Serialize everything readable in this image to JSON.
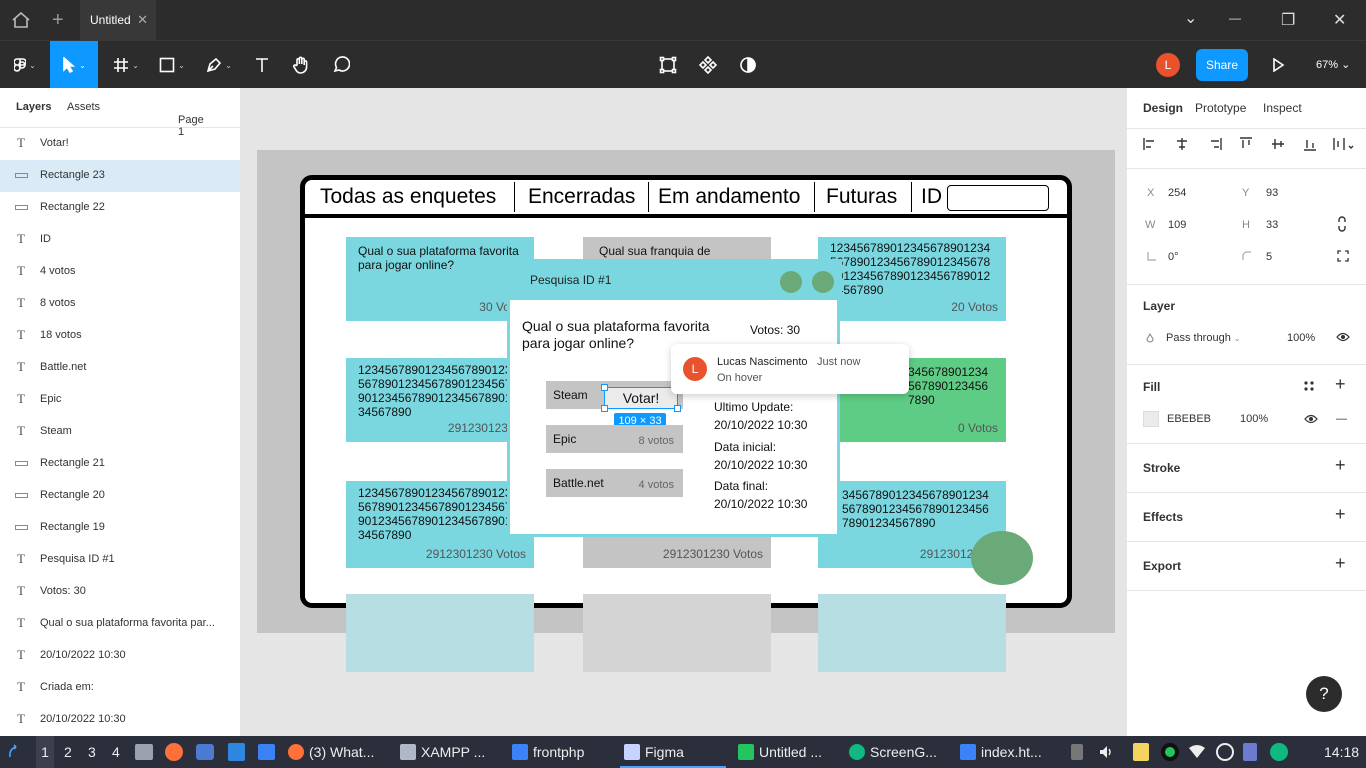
{
  "titlebar": {
    "tab_title": "Untitled",
    "close_glyph": "✕",
    "plus_glyph": "+",
    "chevron_glyph": "⌄",
    "minimize_glyph": "—",
    "restore_glyph": "❐",
    "window_close_glyph": "✕"
  },
  "toolbar": {
    "avatar_letter": "L",
    "share_label": "Share",
    "zoom_label": "67%",
    "caret": "⌄"
  },
  "left_panel": {
    "tab_layers": "Layers",
    "tab_assets": "Assets",
    "page_label": "Page 1",
    "layers": [
      {
        "type": "text",
        "name": "Votar!"
      },
      {
        "type": "rect",
        "name": "Rectangle 23",
        "selected": true
      },
      {
        "type": "rect",
        "name": "Rectangle 22"
      },
      {
        "type": "text",
        "name": "ID"
      },
      {
        "type": "text",
        "name": "4 votos"
      },
      {
        "type": "text",
        "name": "8 votos"
      },
      {
        "type": "text",
        "name": "18 votos"
      },
      {
        "type": "text",
        "name": "Battle.net"
      },
      {
        "type": "text",
        "name": "Epic"
      },
      {
        "type": "text",
        "name": "Steam"
      },
      {
        "type": "rect",
        "name": "Rectangle 21"
      },
      {
        "type": "rect",
        "name": "Rectangle 20"
      },
      {
        "type": "rect",
        "name": "Rectangle 19"
      },
      {
        "type": "text",
        "name": "Pesquisa ID #1"
      },
      {
        "type": "text",
        "name": "Votos: 30"
      },
      {
        "type": "text",
        "name": "Qual o sua plataforma favorita par..."
      },
      {
        "type": "text",
        "name": "20/10/2022 10:30"
      },
      {
        "type": "text",
        "name": "Criada em:"
      },
      {
        "type": "text",
        "name": "20/10/2022 10:30"
      }
    ]
  },
  "right_panel": {
    "tab_design": "Design",
    "tab_prototype": "Prototype",
    "tab_inspect": "Inspect",
    "x_label": "X",
    "x_value": "254",
    "y_label": "Y",
    "y_value": "93",
    "w_label": "W",
    "w_value": "109",
    "h_label": "H",
    "h_value": "33",
    "rotation": "0°",
    "radius": "5",
    "layer_heading": "Layer",
    "blend_mode": "Pass through",
    "layer_opacity": "100%",
    "fill_heading": "Fill",
    "fill_hex": "EBEBEB",
    "fill_opacity": "100%",
    "stroke_heading": "Stroke",
    "effects_heading": "Effects",
    "export_heading": "Export",
    "plus": "+",
    "minus": "—"
  },
  "canvas": {
    "nav": {
      "tabs": [
        "Todas as  enquetes",
        "Encerradas",
        "Em andamento",
        "Futuras",
        "ID"
      ]
    },
    "cards": {
      "c1_text": "Qual o sua plataforma favorita para jogar online?",
      "c1_votes": "30 Votos",
      "c2_text": "Qual sua franquia de",
      "c3_text": "12345678901234567890123456789012345678901234567890123456789012345678901234567890",
      "c3_votes": "20 Votos",
      "c4_text": "12345678901234567890123456789012345678901234567890123456789012345678901234567890",
      "c4_votes": "2912301230 Vo",
      "c6_text": "3456789012345678901234567890",
      "c6_votes": "0 Votos",
      "c7_text": "12345678901234567890123456789012345678901234567890123456789012345678901234567890",
      "c7_votes": "2912301230 Votos",
      "c8_votes": "2912301230 Votos",
      "c9_text": "3456789012345678901234567890123456789012345678901234567890",
      "c9_votes": "2912301230 Vo"
    },
    "modal": {
      "title": "Pesquisa ID #1",
      "question": "Qual o sua plataforma favorita para jogar online?",
      "votes": "Votos: 30",
      "options": [
        {
          "name": "Steam",
          "votes": ""
        },
        {
          "name": "Epic",
          "votes": "8 votos"
        },
        {
          "name": "Battle.net",
          "votes": "4 votos"
        }
      ],
      "vote_button": "Votar!",
      "size_badge": "109 × 33",
      "last_update_label": "Ultimo Update:",
      "last_update_value": "20/10/2022 10:30",
      "start_label": "Data inicial:",
      "start_value": "20/10/2022 10:30",
      "end_label": "Data final:",
      "end_value": "20/10/2022 10:30"
    },
    "comment": {
      "avatar": "L",
      "author": "Lucas Nascimento",
      "time": "Just now",
      "text": "On hover"
    }
  },
  "help_label": "?",
  "taskbar": {
    "workspaces": [
      "1",
      "2",
      "3",
      "4"
    ],
    "apps": [
      {
        "label": "(3) What...",
        "color": "#ff7139"
      },
      {
        "label": "XAMPP ...",
        "color": "#b0b8c8"
      },
      {
        "label": "frontphp",
        "color": "#3b82f6"
      },
      {
        "label": "Figma",
        "color": "#c7d2fe"
      },
      {
        "label": "Untitled ...",
        "color": "#22c55e"
      },
      {
        "label": "ScreenG...",
        "color": "#10b981"
      },
      {
        "label": "index.ht...",
        "color": "#3b82f6"
      }
    ],
    "clock": "14:18"
  }
}
